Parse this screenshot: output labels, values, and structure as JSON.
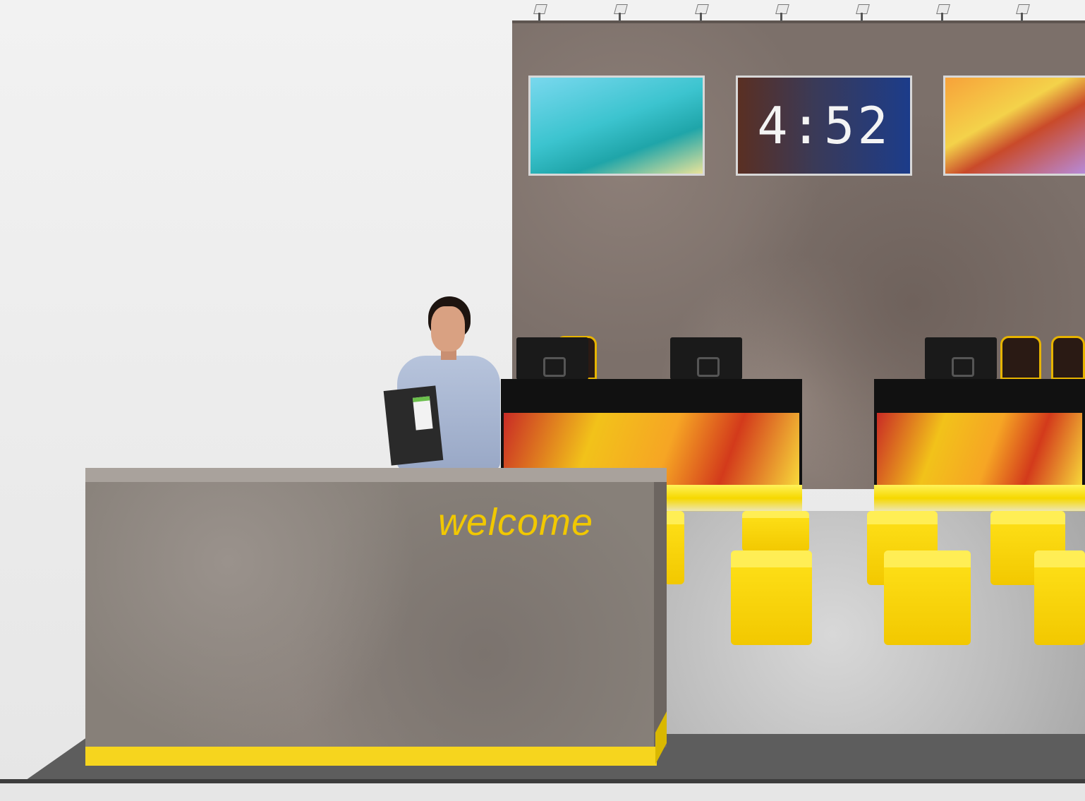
{
  "scene": {
    "counter_sign": "welcome",
    "clock_display": "4:52"
  },
  "colors": {
    "accent_yellow": "#f6d51e",
    "wall": "#7c706a",
    "counter": "#878079"
  }
}
